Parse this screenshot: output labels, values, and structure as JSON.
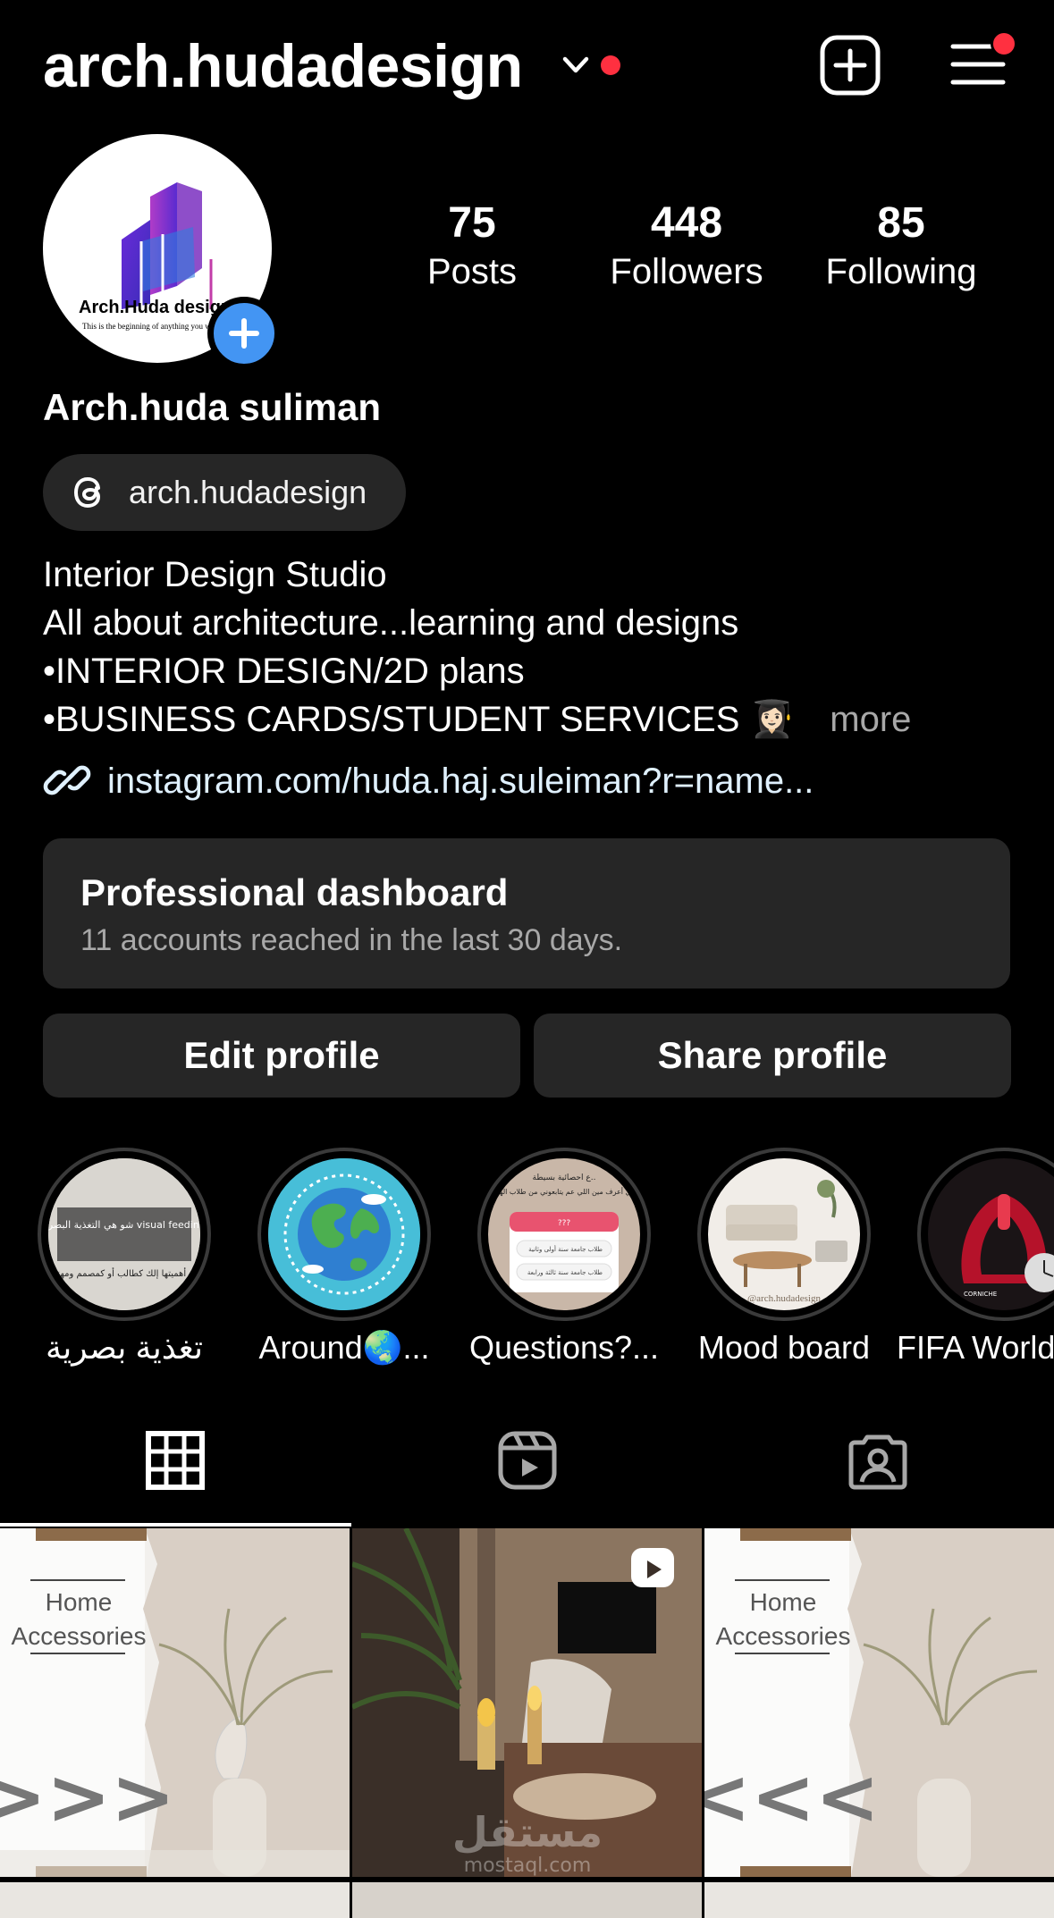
{
  "header": {
    "username": "arch.hudadesign",
    "icons": [
      "chevron-down-icon",
      "new-post-icon",
      "menu-icon"
    ]
  },
  "profile": {
    "avatar_logo_text": "Arch.Huda design",
    "avatar_tagline": "This is the beginning of anything you want",
    "stats": [
      {
        "value": "75",
        "label": "Posts"
      },
      {
        "value": "448",
        "label": "Followers"
      },
      {
        "value": "85",
        "label": "Following"
      }
    ],
    "full_name": "Arch.huda suliman",
    "threads_handle": "arch.hudadesign",
    "bio_lines": [
      "Interior Design Studio",
      "All about architecture...learning and designs",
      "•INTERIOR DESIGN/2D plans",
      "•BUSINESS CARDS/STUDENT SERVICES 👩🏻‍🎓"
    ],
    "more_label": "more",
    "link": "instagram.com/huda.haj.suleiman?r=name..."
  },
  "dashboard": {
    "title": "Professional dashboard",
    "subtitle": "11 accounts reached in the last 30 days."
  },
  "buttons": {
    "edit": "Edit profile",
    "share": "Share profile"
  },
  "highlights": [
    {
      "label": "تغذية بصرية",
      "thumb_text_1": "شو هي التغذية البصرية أو visual feeding ؟؟",
      "thumb_text_2": "شو هي أهميتها إلك كطالب أو كمصمم ومهندس؟؟"
    },
    {
      "label": "Around🌏..."
    },
    {
      "label": "Questions?...",
      "thumb_text_1": "ع احصائية بسيطة..",
      "thumb_text_2": "بدي أعرف مين اللي عم يتابعوني من طلاب الهندسة😉",
      "opt1": "طلاب جامعة سنة أولى وثانية",
      "opt2": "طلاب جامعة سنة ثالثة ورابعة"
    },
    {
      "label": "Mood board",
      "thumb_text_1": "@arch.hudadesign"
    },
    {
      "label": "FIFA World",
      "thumb_text_1": "CORNICHE"
    }
  ],
  "tabs": [
    "grid-icon",
    "reels-icon",
    "tagged-icon"
  ],
  "posts": [
    {
      "title_1": "Home",
      "title_2": "Accessories",
      "arrow": ">>>"
    },
    {
      "watermark_1": "مستقل",
      "watermark_2": "mostaql.com"
    },
    {
      "title_1": "Home",
      "title_2": "Accessories",
      "arrow": "<<<"
    }
  ],
  "colors": {
    "background": "#000000",
    "surface": "#262626",
    "notification": "#ff3040",
    "accent_blue": "#4395f3",
    "muted_text": "#a8a8a8"
  }
}
